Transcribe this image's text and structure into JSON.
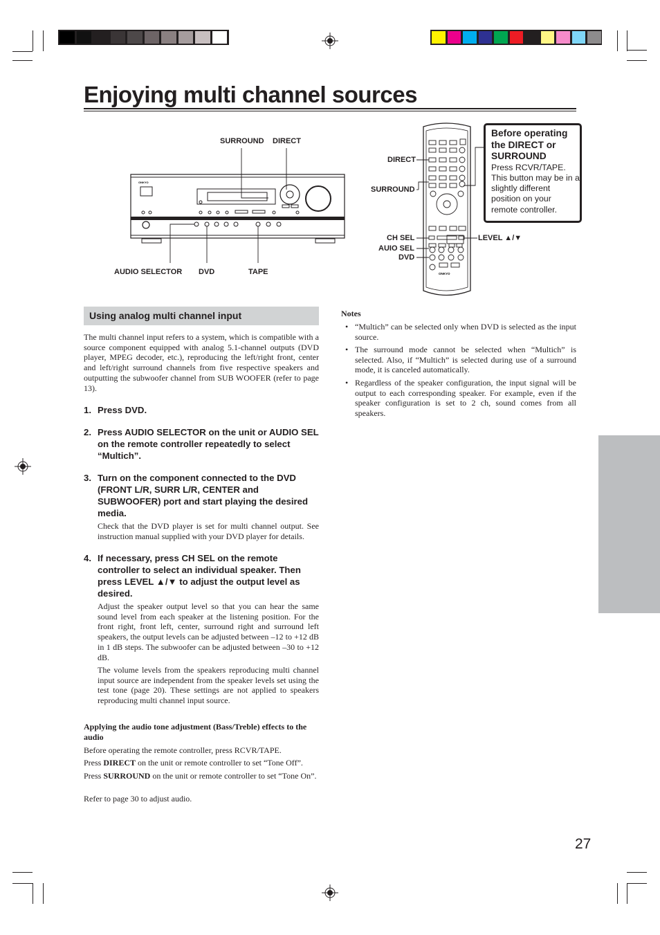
{
  "color_bars": {
    "grayscale": [
      "#000000",
      "#111111",
      "#231f20",
      "#3a3536",
      "#4d4849",
      "#6d6466",
      "#8a8081",
      "#a59c9d",
      "#c8bfc0",
      "#ffffff"
    ],
    "process": [
      "#fff200",
      "#ec008c",
      "#00aeef",
      "#2e3192",
      "#00a651",
      "#ed1c24",
      "#231f20",
      "#fff685",
      "#f68bca",
      "#7fd6f7",
      "#8d8b8c"
    ]
  },
  "page_title": "Enjoying multi channel sources",
  "unit_diagram": {
    "brand": "ONKYO",
    "labels": {
      "surround": "SURROUND",
      "direct": "DIRECT",
      "audio_selector": "AUDIO SELECTOR",
      "dvd": "DVD",
      "tape": "TAPE"
    }
  },
  "remote_diagram": {
    "brand": "ONKYO",
    "labels": {
      "direct": "DIRECT",
      "surround": "SURROUND",
      "ch_sel": "CH SEL",
      "audio_sel": "AUIO SEL",
      "dvd": "DVD",
      "level": "LEVEL ▲/▼"
    }
  },
  "callout": {
    "title": "Before operating the DIRECT or SURROUND",
    "body": "Press RCVR/TAPE. This button may be in a slightly different position on your remote controller."
  },
  "section": {
    "heading": "Using analog multi channel input",
    "intro": "The multi channel input refers to a system, which is compatible with a source component equipped with analog 5.1-channel outputs (DVD player, MPEG decoder, etc.), reproducing the left/right front, center and left/right surround channels from five respective speakers and outputting the subwoofer channel from SUB WOOFER (refer to page 13).",
    "steps": [
      {
        "num": "1.",
        "text": "Press DVD."
      },
      {
        "num": "2.",
        "text": "Press AUDIO SELECTOR on the unit or AUDIO SEL on the remote controller repeatedly to select “Multich”."
      },
      {
        "num": "3.",
        "text": "Turn on the component connected to the DVD (FRONT L/R, SURR L/R, CENTER and SUBWOOFER) port and start playing the desired media.",
        "detail": [
          "Check that the DVD player is set for multi channel output. See instruction manual supplied with your DVD player for details."
        ]
      },
      {
        "num": "4.",
        "text": "If necessary, press CH SEL on the remote controller to select an individual speaker. Then press LEVEL ▲/▼ to adjust the output level as desired.",
        "detail": [
          "Adjust the speaker output level so that you can hear the same sound level from each speaker at the listening position. For the front right, front left, center, surround right and surround left speakers, the output levels can be adjusted between –12 to +12 dB in 1 dB steps. The subwoofer can be adjusted between –30 to +12 dB.",
          "The volume levels from the speakers reproducing multi channel input source are independent from the speaker levels set using the test tone (page 20). These settings are not applied to speakers reproducing multi channel input source."
        ]
      }
    ],
    "tone": {
      "heading": "Applying the audio tone adjustment (Bass/Treble) effects to the audio",
      "p1": "Before operating the remote controller, press RCVR/TAPE.",
      "p2_pre": "Press ",
      "p2_bold": "DIRECT",
      "p2_post": " on the unit or remote controller to set “Tone Off”.",
      "p3_pre": "Press ",
      "p3_bold": "SURROUND",
      "p3_post": " on the unit or remote controller to set “Tone On”.",
      "p4": "Refer to page 30 to adjust audio."
    }
  },
  "notes": {
    "heading": "Notes",
    "items": [
      "“Multich” can be selected only when DVD is selected as the input source.",
      "The surround mode cannot be selected when “Multich” is selected. Also, if “Multich” is selected during use of a surround mode, it is canceled automatically.",
      "Regardless of the speaker configuration, the input signal will be output to each corresponding speaker. For example, even if the speaker configuration is set to 2 ch, sound comes from all speakers."
    ]
  },
  "page_number": "27"
}
